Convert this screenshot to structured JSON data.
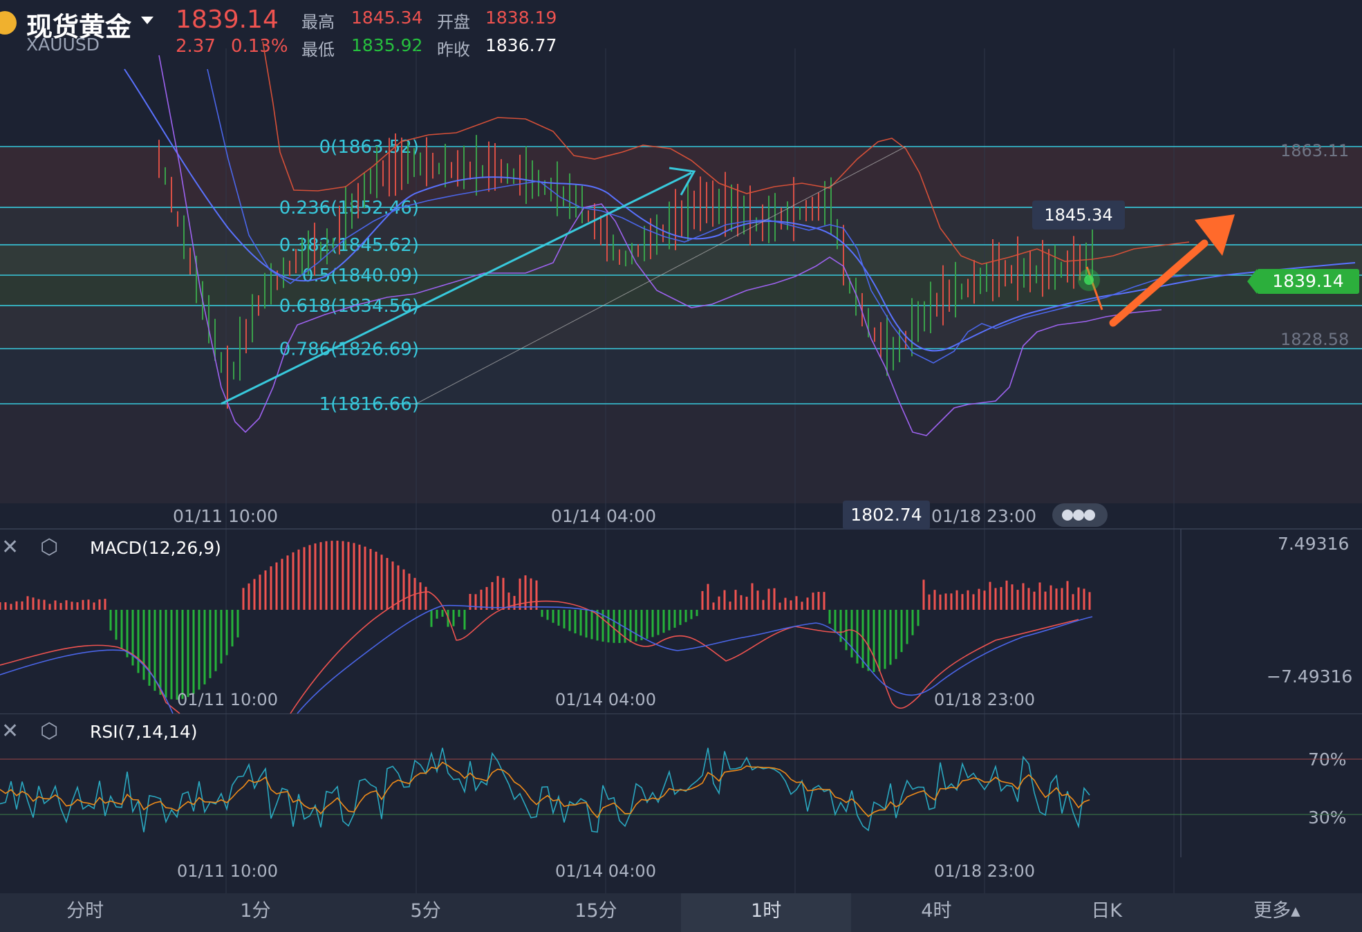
{
  "header": {
    "title": "现货黄金",
    "symbol": "XAUUSD",
    "price": "1839.14",
    "change": "2.37",
    "change_pct": "0.13%",
    "high_label": "最高",
    "high": "1845.34",
    "open_label": "开盘",
    "open": "1838.19",
    "low_label": "最低",
    "low": "1835.92",
    "prev_close_label": "昨收",
    "prev_close": "1836.77"
  },
  "main_chart": {
    "fib_levels": [
      {
        "label": "0(1863.52)",
        "value": 1863.52
      },
      {
        "label": "0.236(1852.46)",
        "value": 1852.46
      },
      {
        "label": "0.382(1845.62)",
        "value": 1845.62
      },
      {
        "label": "0.5(1840.09)",
        "value": 1840.09
      },
      {
        "label": "0.618(1834.56)",
        "value": 1834.56
      },
      {
        "label": "0.786(1826.69)",
        "value": 1826.69
      },
      {
        "label": "1(1816.66)",
        "value": 1816.66
      }
    ],
    "right_axis": [
      "1863.11",
      "1828.58"
    ],
    "current_price_tag": "1839.14",
    "high_tooltip": "1845.34",
    "low_tooltip": "1802.74",
    "time_labels": [
      "01/11 10:00",
      "01/14 04:00",
      "01/18 23:00"
    ]
  },
  "macd": {
    "title": "MACD(12,26,9)",
    "axis_max": "7.49316",
    "axis_min": "−7.49316",
    "time_labels": [
      "01/11 10:00",
      "01/14 04:00",
      "01/18 23:00"
    ]
  },
  "rsi": {
    "title": "RSI(7,14,14)",
    "level_high": "70%",
    "level_low": "30%",
    "time_labels": [
      "01/11 10:00",
      "01/14 04:00",
      "01/18 23:00"
    ]
  },
  "timeframes": [
    {
      "label": "分时",
      "active": false
    },
    {
      "label": "1分",
      "active": false
    },
    {
      "label": "5分",
      "active": false
    },
    {
      "label": "15分",
      "active": false
    },
    {
      "label": "1时",
      "active": true
    },
    {
      "label": "4时",
      "active": false
    },
    {
      "label": "日K",
      "active": false
    },
    {
      "label": "更多▴",
      "active": false
    }
  ],
  "colors": {
    "up": "#ef5350",
    "down": "#26b33a",
    "fib": "#38c9dc",
    "accent_arrow": "#ff6a2b",
    "background": "#1c2232"
  }
}
